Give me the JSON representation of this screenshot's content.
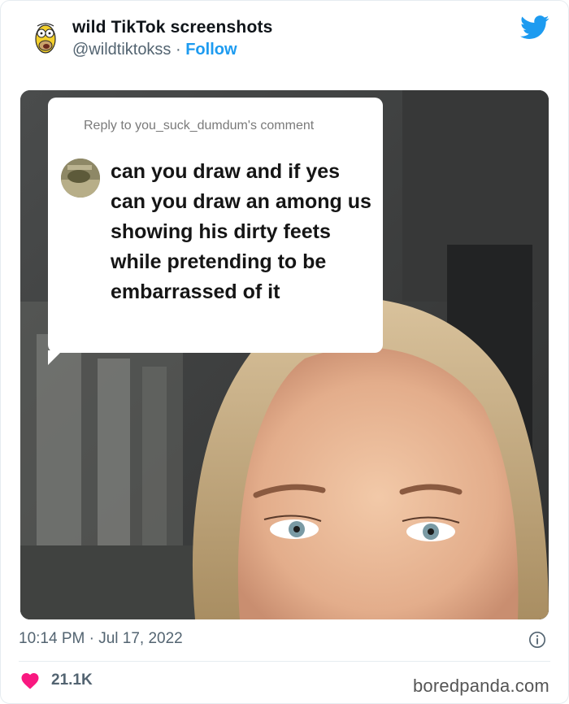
{
  "tweet": {
    "author_name": "wild TikTok screenshots",
    "author_handle": "@wildtiktokss",
    "separator": " · ",
    "follow_label": "Follow",
    "timestamp": "10:14 PM · Jul 17, 2022",
    "like_count": "21.1K"
  },
  "media": {
    "reply_label": "Reply to you_suck_dumdum's comment",
    "comment_text": "can you draw and if yes can you draw an among us showing his dirty feets while pretending to be embarrassed of it"
  },
  "watermark": "boredpanda.com",
  "colors": {
    "twitter_blue": "#1d9bf0",
    "like_pink": "#f91880",
    "secondary_text": "#536471"
  },
  "icons": {
    "brand": "twitter-bird-icon",
    "info": "info-icon",
    "like": "heart-icon"
  }
}
